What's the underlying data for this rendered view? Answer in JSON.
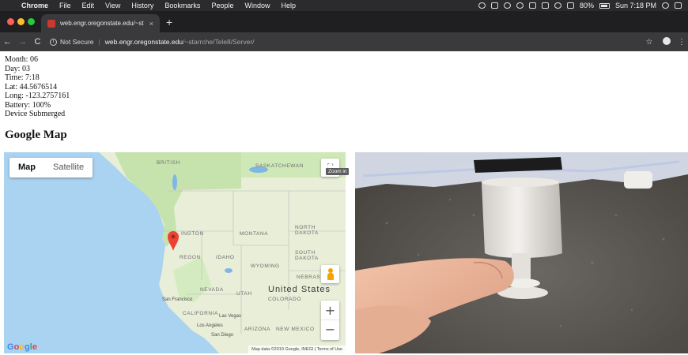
{
  "menubar": {
    "app": "Chrome",
    "items": [
      "File",
      "Edit",
      "View",
      "History",
      "Bookmarks",
      "People",
      "Window",
      "Help"
    ],
    "battery": "80%",
    "clock": "Sun 7:18 PM"
  },
  "browser": {
    "tab_title": "web.engr.oregonstate.edu/~st",
    "omnibox": {
      "security_label": "Not Secure",
      "host": "web.engr.oregonstate.edu",
      "path": "/~starrche/Tele8/Server/"
    }
  },
  "device": {
    "month": "Month: 06",
    "day": "Day: 03",
    "time": "Time: 7:18",
    "lat": "Lat: 44.5676514",
    "long": "Long: -123.2757161",
    "battery": "Battery: 100%",
    "status": "Device Submerged"
  },
  "map": {
    "heading": "Google Map",
    "type_options": [
      "Map",
      "Satellite"
    ],
    "selected_type": "Map",
    "country_label": "United States",
    "region_labels": {
      "saskatchewan": "SASKATCHEWAN",
      "british_columbia": "BRITISH\nCOLUMBIA",
      "montana": "MONTANA",
      "north_dakota": "NORTH\nDAKOTA",
      "washington": "WASHINGTON",
      "oregon": "OREGON",
      "idaho": "IDAHO",
      "south_dakota": "SOUTH\nDAKOTA",
      "wyoming": "WYOMING",
      "nebraska": "NEBRAS",
      "nevada": "NEVADA",
      "utah": "UTAH",
      "colorado": "COLORADO",
      "california": "CALIFORNIA",
      "arizona": "ARIZONA",
      "new_mexico": "NEW MEXICO"
    },
    "city_labels": {
      "san_francisco": "San Francisco",
      "las_vegas": "Las Vegas",
      "los_angeles": "Los Angeles",
      "san_diego": "San Diego"
    },
    "zoom_tooltip": "Zoom in",
    "logo": "Google",
    "attribution": "Map data ©2019 Google, INEGI  |  Terms of Use",
    "colors": {
      "water": "#a9d3f1",
      "land": "#e8eed8",
      "forest": "#c6e3ae",
      "marker": "#ea4335"
    }
  },
  "icons": {
    "close": "×",
    "new_tab": "+",
    "back": "←",
    "forward": "→",
    "reload": "C",
    "star": "☆",
    "kebab": "⋮",
    "fullscreen": "⛶",
    "zoom_in": "+",
    "zoom_out": "−"
  }
}
